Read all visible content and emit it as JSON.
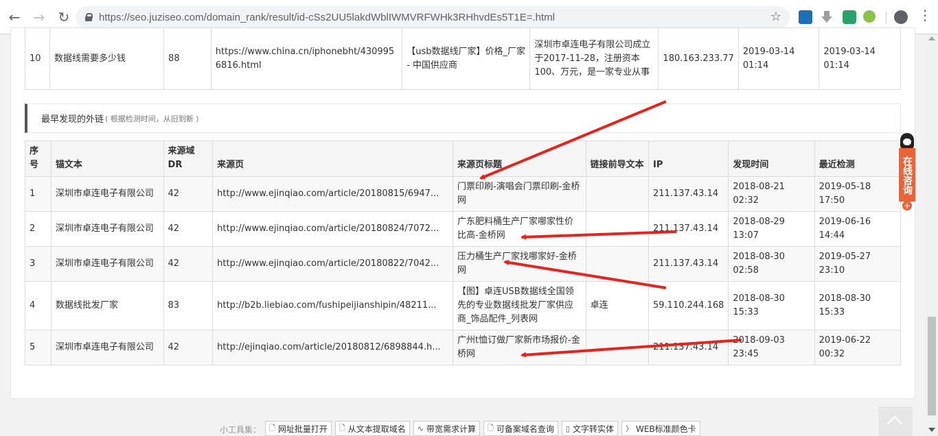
{
  "browser": {
    "url": "https://seo.juziseo.com/domain_rank/result/id-cSs2UU5lakdWblIWMVRFWHk3RHhvdEs5T1E=.html"
  },
  "top_row": {
    "cells": [
      "10",
      "数据线需要多少钱",
      "88",
      "https://www.china.cn/iphonebht/4309956816.html",
      "【usb数据线厂家】价格_厂家 - 中国供应商",
      "深圳市卓连电子有限公司成立于2017-11-28，注册资本100、万元，是一家专业从事",
      "180.163.233.77",
      "2019-03-14 01:14",
      "2019-03-14 01:14"
    ]
  },
  "section": {
    "title": "最早发现的外链",
    "subtitle": "( 根据检测时间，从旧到新 )"
  },
  "table": {
    "headers": [
      "序号",
      "锚文本",
      "来源域DR",
      "来源页",
      "来源页标题",
      "链接前导文本",
      "IP",
      "发现时间",
      "最近检测"
    ],
    "rows": [
      [
        "1",
        "深圳市卓连电子有限公司",
        "42",
        "http://www.ejinqiao.com/article/20180815/6947...",
        "门票印刷-演唱会门票印刷-金桥网",
        "",
        "211.137.43.14",
        "2018-08-21 02:32",
        "2019-05-18 17:50"
      ],
      [
        "2",
        "深圳市卓连电子有限公司",
        "42",
        "http://www.ejinqiao.com/article/20180824/7072...",
        "广东肥料桶生产厂家哪家性价比高-金桥网",
        "",
        "211.137.43.14",
        "2018-08-29 13:07",
        "2019-06-16 14:44"
      ],
      [
        "3",
        "深圳市卓连电子有限公司",
        "42",
        "http://www.ejinqiao.com/article/20180822/7042...",
        "压力桶生产厂家找哪家好-金桥网",
        "",
        "211.137.43.14",
        "2018-08-30 02:58",
        "2019-05-27 23:10"
      ],
      [
        "4",
        "数据线批发厂家",
        "83",
        "http://b2b.liebiao.com/fushipeijianshipin/48211...",
        "【图】卓连USB数据线全国领先的专业数据线批发厂家供应商_饰品配件_列表网",
        "卓连",
        "59.110.244.168",
        "2018-08-30 15:33",
        "2018-08-30 15:33"
      ],
      [
        "5",
        "深圳市卓连电子有限公司",
        "42",
        "http://ejinqiao.com/article/20180812/6898844.h...",
        "广州t恤订做厂家新市场报价-金桥网",
        "",
        "211.137.43.14",
        "2018-09-03 23:45",
        "2019-06-22 00:32"
      ]
    ]
  },
  "widget": {
    "label": "在线咨询",
    "plus": "+"
  },
  "tools": {
    "label": "小工具集：",
    "items": [
      "网址批量打开",
      "从文本提取域名",
      "带宽需求计算",
      "可备案域名查询",
      "文字转实体",
      "WEB标准颜色卡"
    ],
    "icons": [
      "document-icon",
      "document-icon",
      "pulse-icon",
      "document-icon",
      "book-icon",
      "chevron-right-icon"
    ]
  },
  "colors": {
    "arrow": "#e8231e",
    "widget": "#e8653a"
  }
}
